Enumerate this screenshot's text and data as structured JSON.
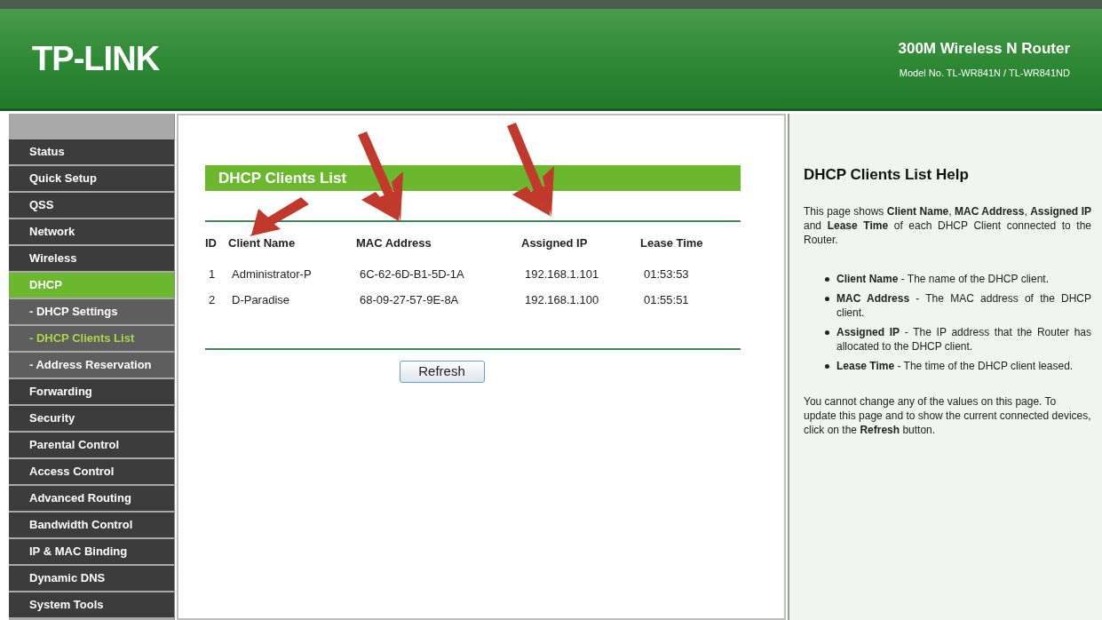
{
  "header": {
    "brand": "TP-LINK",
    "product": "300M Wireless N Router",
    "model": "Model No. TL-WR841N / TL-WR841ND"
  },
  "sidebar": {
    "items": [
      {
        "label": "Status",
        "selected": false
      },
      {
        "label": "Quick Setup",
        "selected": false
      },
      {
        "label": "QSS",
        "selected": false
      },
      {
        "label": "Network",
        "selected": false
      },
      {
        "label": "Wireless",
        "selected": false
      },
      {
        "label": "DHCP",
        "selected": true,
        "children": [
          {
            "label": "- DHCP Settings",
            "selected": false
          },
          {
            "label": "- DHCP Clients List",
            "selected": true
          },
          {
            "label": "- Address Reservation",
            "selected": false
          }
        ]
      },
      {
        "label": "Forwarding",
        "selected": false
      },
      {
        "label": "Security",
        "selected": false
      },
      {
        "label": "Parental Control",
        "selected": false
      },
      {
        "label": "Access Control",
        "selected": false
      },
      {
        "label": "Advanced Routing",
        "selected": false
      },
      {
        "label": "Bandwidth Control",
        "selected": false
      },
      {
        "label": "IP & MAC Binding",
        "selected": false
      },
      {
        "label": "Dynamic DNS",
        "selected": false
      },
      {
        "label": "System Tools",
        "selected": false
      }
    ]
  },
  "panel": {
    "title": "DHCP Clients List",
    "button": "Refresh"
  },
  "table": {
    "columns": [
      "ID",
      "Client Name",
      "MAC Address",
      "Assigned IP",
      "Lease Time"
    ],
    "rows": [
      [
        "1",
        "Administrator-P",
        "6C-62-6D-B1-5D-1A",
        "192.168.1.101",
        "01:53:53"
      ],
      [
        "2",
        "D-Paradise",
        "68-09-27-57-9E-8A",
        "192.168.1.100",
        "01:55:51"
      ]
    ]
  },
  "help": {
    "title": "DHCP Clients List Help",
    "intro": "This page shows **Client Name**, **MAC Address**, **Assigned IP** and **Lease Time** of each DHCP Client connected to the Router.",
    "items": [
      "**Client Name** - The name of the DHCP client.",
      "**MAC Address** - The MAC address of the DHCP client.",
      "**Assigned IP** - The IP address that the Router has allocated to the DHCP client.",
      "**Lease Time** - The time of the DHCP client leased."
    ],
    "footer": "You cannot change any of the values on this page. To update this page and to show the current connected devices, click on the **Refresh** button."
  }
}
